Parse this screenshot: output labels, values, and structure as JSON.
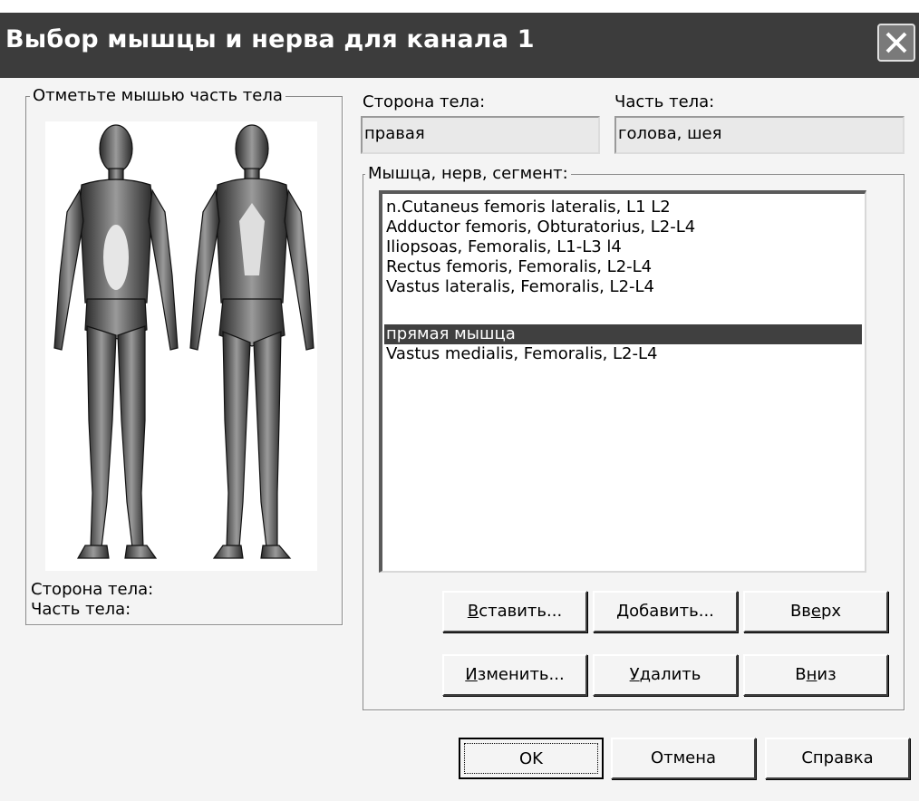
{
  "window": {
    "title": "Выбор мышцы и нерва для канала 1",
    "close_symbol": "✕"
  },
  "body_group": {
    "legend": "Отметьте мышью часть тела",
    "side_label": "Сторона тела:",
    "part_label": "Часть тела:"
  },
  "side": {
    "label": "Сторона тела:",
    "value": "правая"
  },
  "part": {
    "label": "Часть тела:",
    "value": "голова, шея"
  },
  "muscle_group": {
    "legend": "Мышца, нерв, сегмент:",
    "items": [
      "n.Cutaneus femoris lateralis, L1 L2",
      "Adductor femoris, Obturatorius, L2-L4",
      "Iliopsoas, Femoralis, L1-L3 l4",
      "Rectus femoris, Femoralis, L2-L4",
      "Vastus lateralis, Femoralis, L2-L4",
      "прямая мышца",
      "Vastus medialis, Femoralis, L2-L4"
    ],
    "selected_index": 5
  },
  "buttons": {
    "insert": {
      "pre": "",
      "u": "В",
      "post": "ставить..."
    },
    "add": {
      "pre": "",
      "u": "Д",
      "post": "обавить..."
    },
    "up": {
      "pre": "Вв",
      "u": "е",
      "post": "рх"
    },
    "edit": {
      "pre": "",
      "u": "И",
      "post": "зменить..."
    },
    "delete": {
      "pre": "",
      "u": "У",
      "post": "далить"
    },
    "down": {
      "pre": "В",
      "u": "н",
      "post": "из"
    },
    "ok": "OK",
    "cancel": "Отмена",
    "help": "Справка"
  },
  "colors": {
    "titlebar": "#3c3c3c",
    "selection": "#404040",
    "dialog_bg": "#f4f4f4"
  }
}
